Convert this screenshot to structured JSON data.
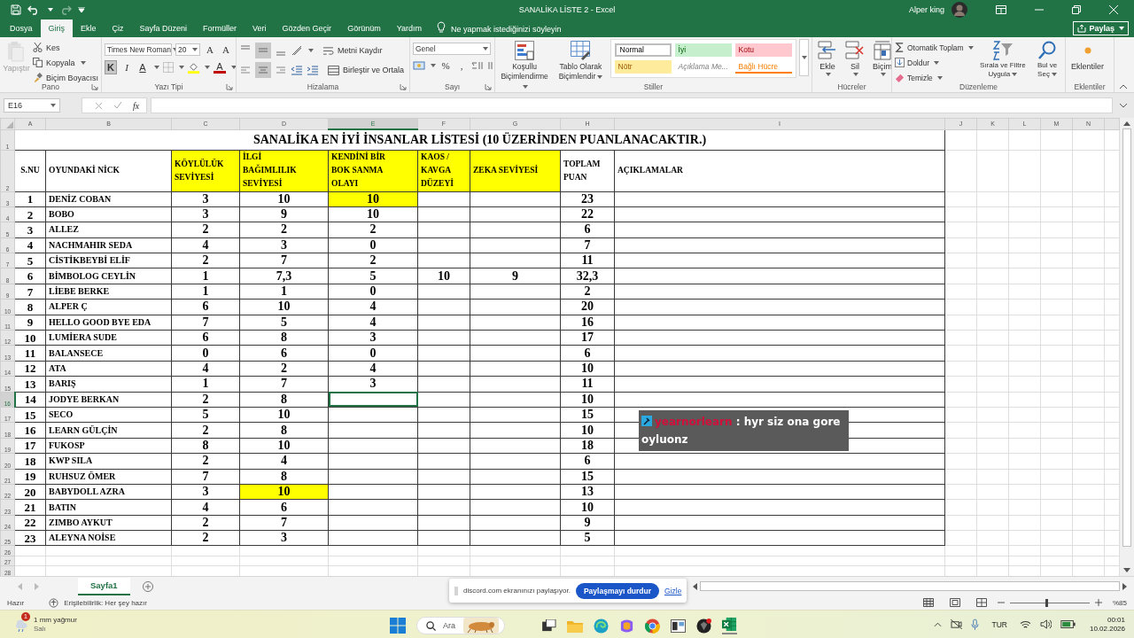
{
  "title_bar": {
    "title": "SANALİKA LİSTE 2 - Excel",
    "user": "Alper king",
    "redo_disabled": true
  },
  "tabs": [
    {
      "label": "Dosya",
      "selected": false
    },
    {
      "label": "Giriş",
      "selected": true
    },
    {
      "label": "Ekle",
      "selected": false
    },
    {
      "label": "Çiz",
      "selected": false
    },
    {
      "label": "Sayfa Düzeni",
      "selected": false
    },
    {
      "label": "Formüller",
      "selected": false
    },
    {
      "label": "Veri",
      "selected": false
    },
    {
      "label": "Gözden Geçir",
      "selected": false
    },
    {
      "label": "Görünüm",
      "selected": false
    },
    {
      "label": "Yardım",
      "selected": false
    }
  ],
  "tell_me": "Ne yapmak istediğinizi söyleyin",
  "share_button": "Paylaş",
  "ribbon": {
    "clipboard": {
      "label": "Pano",
      "paste": {
        "label": "Yapıştır",
        "disabled": true
      },
      "cut": "Kes",
      "copy": "Kopyala",
      "format_painter": "Biçim Boyacısı"
    },
    "font": {
      "label": "Yazı Tipi",
      "family": "Times New Roman",
      "size": "20",
      "grow": "A",
      "shrink": "A",
      "bold": {
        "text": "K",
        "selected": true
      },
      "italic": "I",
      "underline": "A",
      "font_color": "A"
    },
    "alignment": {
      "label": "Hizalama",
      "wrap": "Metni Kaydır",
      "merge": "Birleştir ve Ortala",
      "middle_selected": true,
      "center_selected": true
    },
    "number": {
      "label": "Sayı",
      "format": "Genel",
      "percent": "%",
      "comma": ","
    },
    "styles": {
      "label": "Stiller",
      "conditional": "Koşullu Biçimlendirme",
      "table": "Tablo Olarak Biçimlendir",
      "cell_styles": [
        {
          "text": "Normal",
          "kind": "normal",
          "selected": true
        },
        {
          "text": "İyi",
          "kind": "good",
          "selected": false
        },
        {
          "text": "Kotu",
          "kind": "bad",
          "selected": false
        },
        {
          "text": "Nötr",
          "kind": "neutral",
          "selected": false
        },
        {
          "text": "Açıklama Me...",
          "kind": "explanatory",
          "selected": false
        },
        {
          "text": "Bağlı Hücre",
          "kind": "linked",
          "selected": false
        }
      ]
    },
    "cells": {
      "label": "Hücreler",
      "insert": "Ekle",
      "delete": "Sil",
      "format": "Biçim"
    },
    "editing": {
      "label": "Düzenleme",
      "autosum": "Otomatik Toplam",
      "fill": "Doldur",
      "clear": "Temizle",
      "sort": "Sırala ve Filtre Uygula",
      "find": "Bul ve Seç"
    },
    "addins": {
      "label": "Eklentiler",
      "button": "Eklentiler"
    }
  },
  "formula_bar": {
    "name_box": "E16",
    "function_symbol": "fx"
  },
  "sheet": {
    "column_headers": [
      {
        "label": "A",
        "selected": false
      },
      {
        "label": "B",
        "selected": false
      },
      {
        "label": "C",
        "selected": false
      },
      {
        "label": "D",
        "selected": false
      },
      {
        "label": "E",
        "selected": true
      },
      {
        "label": "F",
        "selected": false
      },
      {
        "label": "G",
        "selected": false
      },
      {
        "label": "H",
        "selected": false
      },
      {
        "label": "I",
        "selected": false
      },
      {
        "label": "J",
        "selected": false
      },
      {
        "label": "K",
        "selected": false
      },
      {
        "label": "L",
        "selected": false
      },
      {
        "label": "M",
        "selected": false
      },
      {
        "label": "N",
        "selected": false
      }
    ],
    "title_row": {
      "row_header": "1",
      "text": "SANALİKA EN İYİ İNSANLAR LİSTESİ (10 ÜZERİNDEN PUANLANACAKTIR.)"
    },
    "header_row": {
      "row_header": "2",
      "cells": [
        "S.NU",
        "OYUNDAKİ NİCK",
        "KÖYLÜLÜK\nSEVİYESİ",
        "İLGİ\nBAĞIMLILIK\nSEVİYESİ",
        "KENDİNİ BİR\nBOK SANMA\nOLAYI",
        "KAOS /\nKAVGA\nDÜZEYİ",
        "ZEKA SEVİYESİ",
        "TOPLAM\nPUAN",
        "AÇIKLAMALAR"
      ],
      "highlighted": [
        false,
        false,
        true,
        true,
        true,
        true,
        true,
        false,
        false
      ]
    },
    "rows": [
      {
        "row_header": "3",
        "selected": false,
        "cells": [
          "1",
          "DENİZ COBAN",
          "3",
          "10",
          "10",
          null,
          null,
          "23"
        ],
        "highlighted": [
          false,
          false,
          false,
          false,
          true,
          false,
          false,
          false
        ]
      },
      {
        "row_header": "4",
        "selected": false,
        "cells": [
          "2",
          "BOBO",
          "3",
          "9",
          "10",
          null,
          null,
          "22"
        ]
      },
      {
        "row_header": "5",
        "selected": false,
        "cells": [
          "3",
          "ALLEZ",
          "2",
          "2",
          "2",
          null,
          null,
          "6"
        ]
      },
      {
        "row_header": "6",
        "selected": false,
        "cells": [
          "4",
          "NACHMAHIR SEDA",
          "4",
          "3",
          "0",
          null,
          null,
          "7"
        ]
      },
      {
        "row_header": "7",
        "selected": false,
        "cells": [
          "5",
          "CİSTİKBEYBİ ELİF",
          "2",
          "7",
          "2",
          null,
          null,
          "11"
        ]
      },
      {
        "row_header": "8",
        "selected": false,
        "cells": [
          "6",
          "BİMBOLOG CEYLİN",
          "1",
          "7,3",
          "5",
          "10",
          "9",
          "32,3"
        ]
      },
      {
        "row_header": "9",
        "selected": false,
        "cells": [
          "7",
          "LİEBE BERKE",
          "1",
          "1",
          "0",
          null,
          null,
          "2"
        ]
      },
      {
        "row_header": "10",
        "selected": false,
        "cells": [
          "8",
          "ALPER Ç",
          "6",
          "10",
          "4",
          null,
          null,
          "20"
        ]
      },
      {
        "row_header": "11",
        "selected": false,
        "cells": [
          "9",
          "HELLO GOOD BYE EDA",
          "7",
          "5",
          "4",
          null,
          null,
          "16"
        ]
      },
      {
        "row_header": "12",
        "selected": false,
        "cells": [
          "10",
          "LUMİERA SUDE",
          "6",
          "8",
          "3",
          null,
          null,
          "17"
        ]
      },
      {
        "row_header": "13",
        "selected": false,
        "cells": [
          "11",
          "BALANSECE",
          "0",
          "6",
          "0",
          null,
          null,
          "6"
        ]
      },
      {
        "row_header": "14",
        "selected": false,
        "cells": [
          "12",
          "ATA",
          "4",
          "2",
          "4",
          null,
          null,
          "10"
        ]
      },
      {
        "row_header": "15",
        "selected": false,
        "cells": [
          "13",
          "BARIŞ",
          "1",
          "7",
          "3",
          null,
          null,
          "11"
        ]
      },
      {
        "row_header": "16",
        "selected": true,
        "cells": [
          "14",
          "JODYE BERKAN",
          "2",
          "8",
          null,
          null,
          null,
          "10"
        ]
      },
      {
        "row_header": "17",
        "selected": false,
        "cells": [
          "15",
          "SECO",
          "5",
          "10",
          null,
          null,
          null,
          "15"
        ]
      },
      {
        "row_header": "18",
        "selected": false,
        "cells": [
          "16",
          "LEARN GÜLÇİN",
          "2",
          "8",
          null,
          null,
          null,
          "10"
        ]
      },
      {
        "row_header": "19",
        "selected": false,
        "cells": [
          "17",
          "FUKOSP",
          "8",
          "10",
          null,
          null,
          null,
          "18"
        ]
      },
      {
        "row_header": "20",
        "selected": false,
        "cells": [
          "18",
          "KWP SILA",
          "2",
          "4",
          null,
          null,
          null,
          "6"
        ]
      },
      {
        "row_header": "21",
        "selected": false,
        "cells": [
          "19",
          "RUHSUZ ÖMER",
          "7",
          "8",
          null,
          null,
          null,
          "15"
        ]
      },
      {
        "row_header": "22",
        "selected": false,
        "cells": [
          "20",
          "BABYDOLL AZRA",
          "3",
          "10",
          null,
          null,
          null,
          "13"
        ],
        "highlighted": [
          false,
          false,
          false,
          true,
          false,
          false,
          false,
          false
        ]
      },
      {
        "row_header": "23",
        "selected": false,
        "cells": [
          "21",
          "BATIN",
          "4",
          "6",
          null,
          null,
          null,
          "10"
        ]
      },
      {
        "row_header": "24",
        "selected": false,
        "cells": [
          "22",
          "ZIMBO AYKUT",
          "2",
          "7",
          null,
          null,
          null,
          "9"
        ]
      },
      {
        "row_header": "25",
        "selected": false,
        "cells": [
          "23",
          "ALEYNA NOİSE",
          "2",
          "3",
          null,
          null,
          null,
          "5"
        ]
      }
    ],
    "empty_rows": [
      "26",
      "27",
      "28"
    ]
  },
  "chat_overlay": {
    "username": "yearnorlearn",
    "message": ": hyr siz ona gore oyluonz"
  },
  "sheet_tabs": [
    {
      "label": "Sayfa1",
      "selected": true
    }
  ],
  "share_bar": {
    "text": "discord.com ekranınızı paylaşıyor.",
    "stop_button": "Paylaşmayı durdur",
    "hide_link": "Gizle"
  },
  "status_bar": {
    "status": "Hazır",
    "accessibility": "Erişilebilirlik: Her şey hazır",
    "zoom": "%85",
    "level": 0.45
  },
  "taskbar": {
    "weather": "1 mm yağmur",
    "day": "Salı",
    "badge": "1",
    "search": {
      "placeholder": "Ara"
    },
    "language": "TUR",
    "time": "00:01",
    "date": "10.02.2026"
  }
}
